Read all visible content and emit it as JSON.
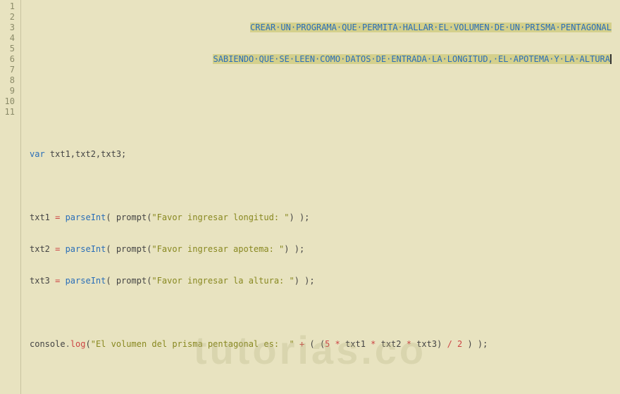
{
  "code": {
    "comment1": "CREAR·UN·PROGRAMA·QUE·PERMITA·HALLAR·EL·VOLUMEN·DE·UN·PRISMA·PENTAGONAL",
    "comment2": "SABIENDO·QUE·SE·LEEN·COMO·DATOS·DE·ENTRADA·LA·LONGITUD,·EL·APOTEMA·Y·LA·ALTURA",
    "var_kw": "var",
    "var_decl": " txt1,txt2,txt3;",
    "assign1_v": "txt1 ",
    "assign2_v": "txt2 ",
    "assign3_v": "txt3 ",
    "eq": "= ",
    "parseInt": "parseInt",
    "prompt": "prompt",
    "lparen": "( ",
    "rparen_sc": ") );",
    "open_call": "(",
    "str1": "\"Favor ingresar longitud: \"",
    "str2": "\"Favor ingresar apotema: \"",
    "str3": "\"Favor ingresar la altura: \"",
    "console": "console",
    "dot": ".",
    "log": "log",
    "log_open": "(",
    "log_str": "\"El volumen del prisma pentagonal es:  \"",
    "plus": " + ",
    "calc_open": "( (",
    "five": "5",
    "star": " * ",
    "txt1": "txt1",
    "txt2": "txt2",
    "txt3": "txt3",
    "calc_close": ") ",
    "slash": "/ ",
    "two": "2",
    "final_close": " ) );"
  },
  "lines": [
    "1",
    "2",
    "3",
    "4",
    "5",
    "6",
    "7",
    "8",
    "9",
    "10",
    "11"
  ],
  "watermark": "tutorias.co"
}
